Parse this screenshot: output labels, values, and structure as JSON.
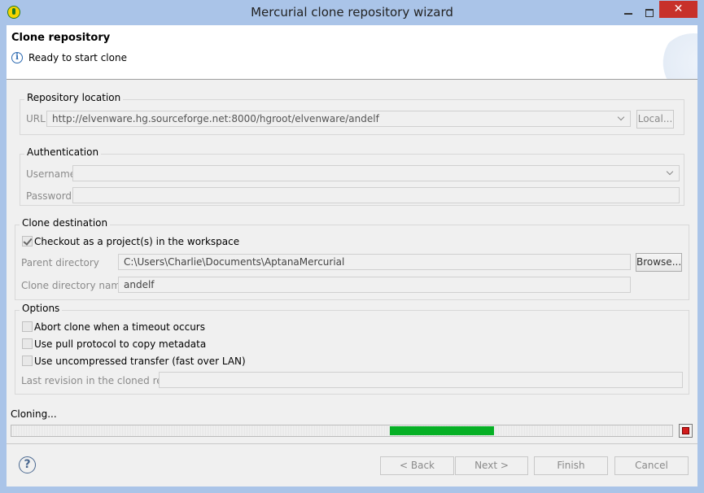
{
  "window": {
    "title": "Mercurial clone repository wizard",
    "close_glyph": "✕"
  },
  "header": {
    "title": "Clone repository",
    "message": "Ready to start clone",
    "info_glyph": "i"
  },
  "repository_location": {
    "title": "Repository location",
    "url_label": "URL",
    "url_value": "http://elvenware.hg.sourceforge.net:8000/hgroot/elvenware/andelf",
    "local_button": "Local..."
  },
  "authentication": {
    "title": "Authentication",
    "username_label": "Username",
    "username_value": "",
    "password_label": "Password",
    "password_value": ""
  },
  "clone_destination": {
    "title": "Clone destination",
    "checkout_label": "Checkout as a project(s) in the workspace",
    "checkout_checked": true,
    "parent_dir_label": "Parent directory",
    "parent_dir_value": "C:\\Users\\Charlie\\Documents\\AptanaMercurial",
    "browse_button": "Browse...",
    "clone_dir_label": "Clone directory name",
    "clone_dir_value": "andelf"
  },
  "options": {
    "title": "Options",
    "abort_label": "Abort clone when a timeout occurs",
    "pull_label": "Use pull protocol to copy metadata",
    "uncompressed_label": "Use uncompressed transfer (fast over LAN)",
    "last_rev_label": "Last revision in the cloned repo",
    "last_rev_value": ""
  },
  "progress": {
    "status": "Cloning...",
    "fill_start": 0.573,
    "fill_fraction": 0.157,
    "fill_color": "#06b025"
  },
  "buttons": {
    "help_glyph": "?",
    "back": "< Back",
    "next": "Next >",
    "finish": "Finish",
    "cancel": "Cancel"
  },
  "colors": {
    "window_frame": "#aac4e8",
    "close_button": "#c7312a",
    "stop_button": "#d21b1b"
  }
}
